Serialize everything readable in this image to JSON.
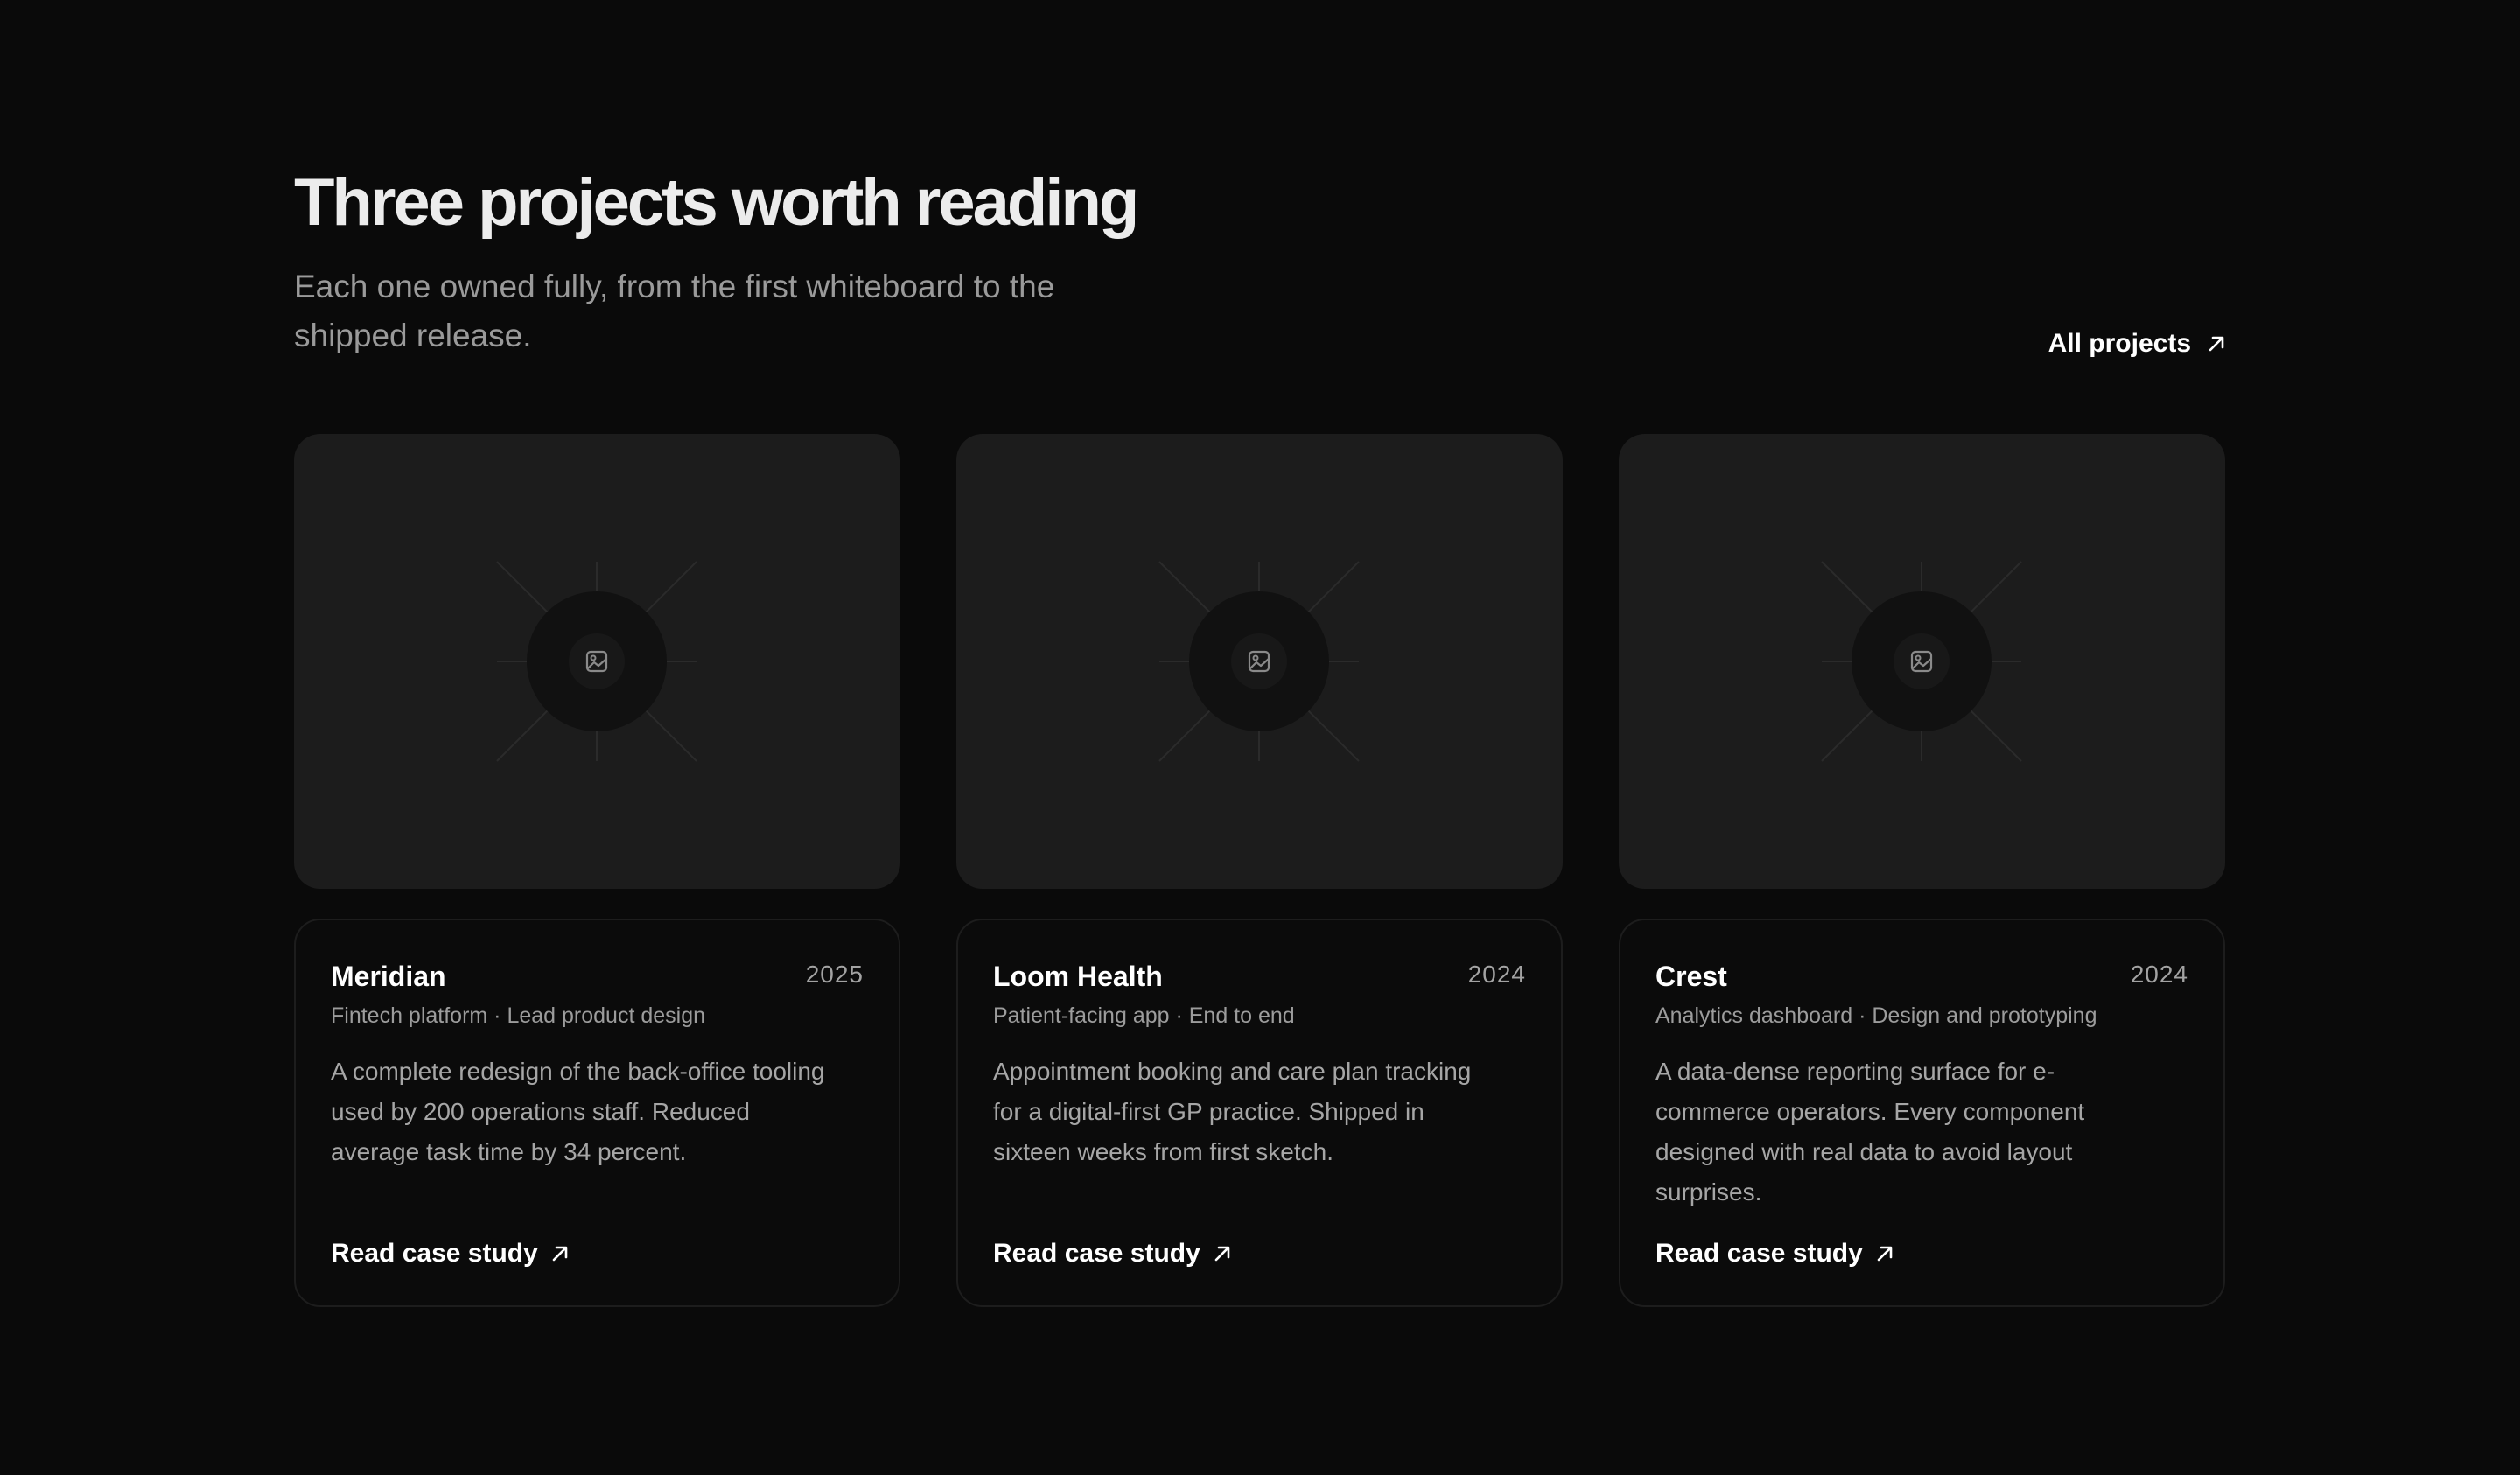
{
  "header": {
    "title": "Three projects worth reading",
    "subtitle": "Each one owned fully, from the first whiteboard to the shipped release.",
    "all_projects_label": "All projects"
  },
  "projects": [
    {
      "name": "Meridian",
      "year": "2025",
      "meta": "Fintech platform · Lead product design",
      "description": "A complete redesign of the back-office tooling used by 200 operations staff. Reduced average task time by 34 percent.",
      "link_label": "Read case study"
    },
    {
      "name": "Loom Health",
      "year": "2024",
      "meta": "Patient-facing app · End to end",
      "description": "Appointment booking and care plan tracking for a digital-first GP practice. Shipped in sixteen weeks from first sketch.",
      "link_label": "Read case study"
    },
    {
      "name": "Crest",
      "year": "2024",
      "meta": "Analytics dashboard · Design and prototyping",
      "description": "A data-dense reporting surface for e-commerce operators. Every component designed with real data to avoid layout surprises.",
      "link_label": "Read case study"
    }
  ],
  "icons": {
    "placeholder": "image-icon",
    "link_arrow": "arrow-up-right-icon"
  },
  "colors": {
    "background": "#0a0a0a",
    "card_media": "#1c1c1c",
    "text_primary": "#ffffff",
    "text_muted": "#9a9a9a"
  }
}
